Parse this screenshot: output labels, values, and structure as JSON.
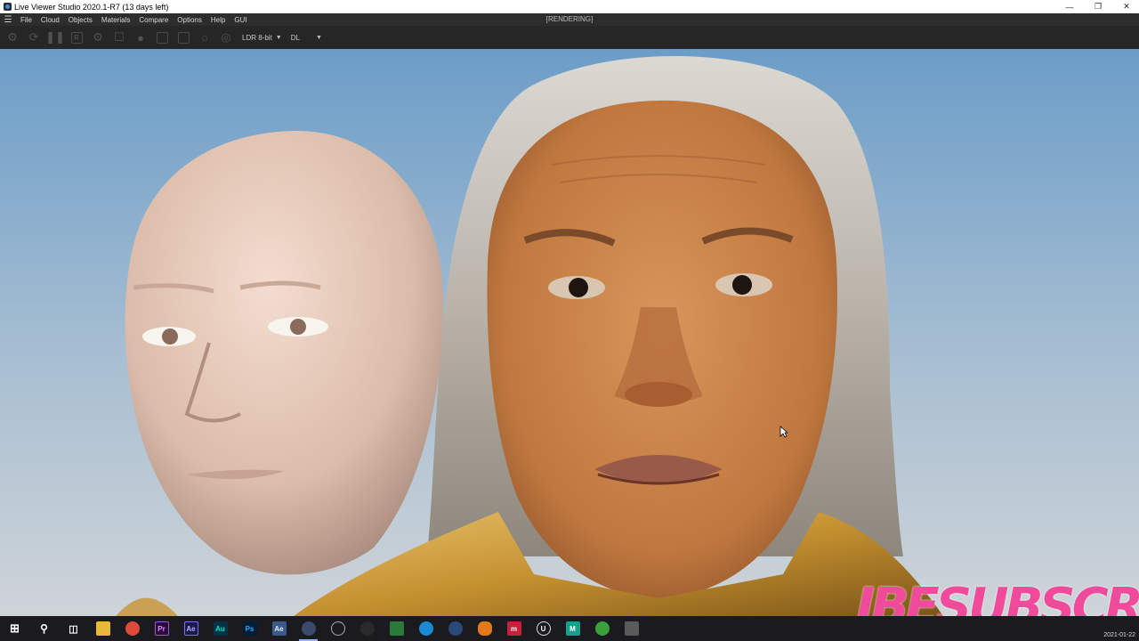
{
  "window": {
    "title": "Live Viewer Studio 2020.1-R7 (13 days left)",
    "minimize_icon": "minimize-icon",
    "maximize_icon": "restore-icon",
    "close_icon": "close-icon"
  },
  "menu": {
    "items": [
      "File",
      "Cloud",
      "Objects",
      "Materials",
      "Compare",
      "Options",
      "Help",
      "GUI"
    ],
    "status": "[RENDERING]"
  },
  "toolbar": {
    "icons": [
      "gear-icon",
      "refresh-icon",
      "pause-icon",
      "region-render-icon",
      "settings-icon",
      "lock-icon",
      "sphere-icon",
      "export-icon",
      "camera-icon",
      "pin-icon"
    ],
    "region_label": "R",
    "color_depth": "LDR 8-bit",
    "render_mode": "DL"
  },
  "viewport": {
    "overlay_text": "IBESUBSCR",
    "colors": {
      "sky_top": "#6f9fc9",
      "sky_bottom": "#c9d3dc",
      "skin": "#c9864f",
      "mannequin": "#e3c3b3",
      "hair": "#cfcac2",
      "robe": "#d8a94d",
      "overlay": "#f04a9a"
    }
  },
  "taskbar": {
    "apps": [
      {
        "name": "start-icon",
        "label": "",
        "color": "#1b1b1f"
      },
      {
        "name": "search-icon",
        "label": "",
        "color": "#1b1b1f"
      },
      {
        "name": "task-view-icon",
        "label": "",
        "color": "#1b1b1f"
      },
      {
        "name": "file-explorer-icon",
        "label": "",
        "color": "#e8b83a"
      },
      {
        "name": "chrome-icon",
        "label": "",
        "color": "#e04a3a"
      },
      {
        "name": "premiere-icon",
        "label": "Pr",
        "color": "#2a0a3a"
      },
      {
        "name": "after-effects-icon",
        "label": "Ae",
        "color": "#1a1a4a"
      },
      {
        "name": "audition-icon",
        "label": "Au",
        "color": "#00324a"
      },
      {
        "name": "photoshop-icon",
        "label": "Ps",
        "color": "#001e36"
      },
      {
        "name": "app-icon-ae2",
        "label": "Ae",
        "color": "#3a5a8a"
      },
      {
        "name": "cinema4d-icon",
        "label": "",
        "color": "#3b4a6a"
      },
      {
        "name": "blender-icon",
        "label": "",
        "color": "#2a2a2a"
      },
      {
        "name": "app-dark-icon",
        "label": "",
        "color": "#1b1b1f"
      },
      {
        "name": "green-app-icon",
        "label": "",
        "color": "#2c7a3a"
      },
      {
        "name": "edge-icon",
        "label": "",
        "color": "#1a8ad4"
      },
      {
        "name": "steam-icon",
        "label": "",
        "color": "#2a4a7a"
      },
      {
        "name": "vlc-icon",
        "label": "",
        "color": "#e07a1a"
      },
      {
        "name": "red-app-icon",
        "label": "m",
        "color": "#c8203a"
      },
      {
        "name": "unreal-icon",
        "label": "U",
        "color": "#1b1b1f"
      },
      {
        "name": "maya-icon",
        "label": "M",
        "color": "#1aa08a"
      },
      {
        "name": "green-circle-icon",
        "label": "",
        "color": "#3aa03a"
      },
      {
        "name": "window-icon",
        "label": "",
        "color": "#5a5a5a"
      }
    ],
    "date": "2021-01-22"
  }
}
